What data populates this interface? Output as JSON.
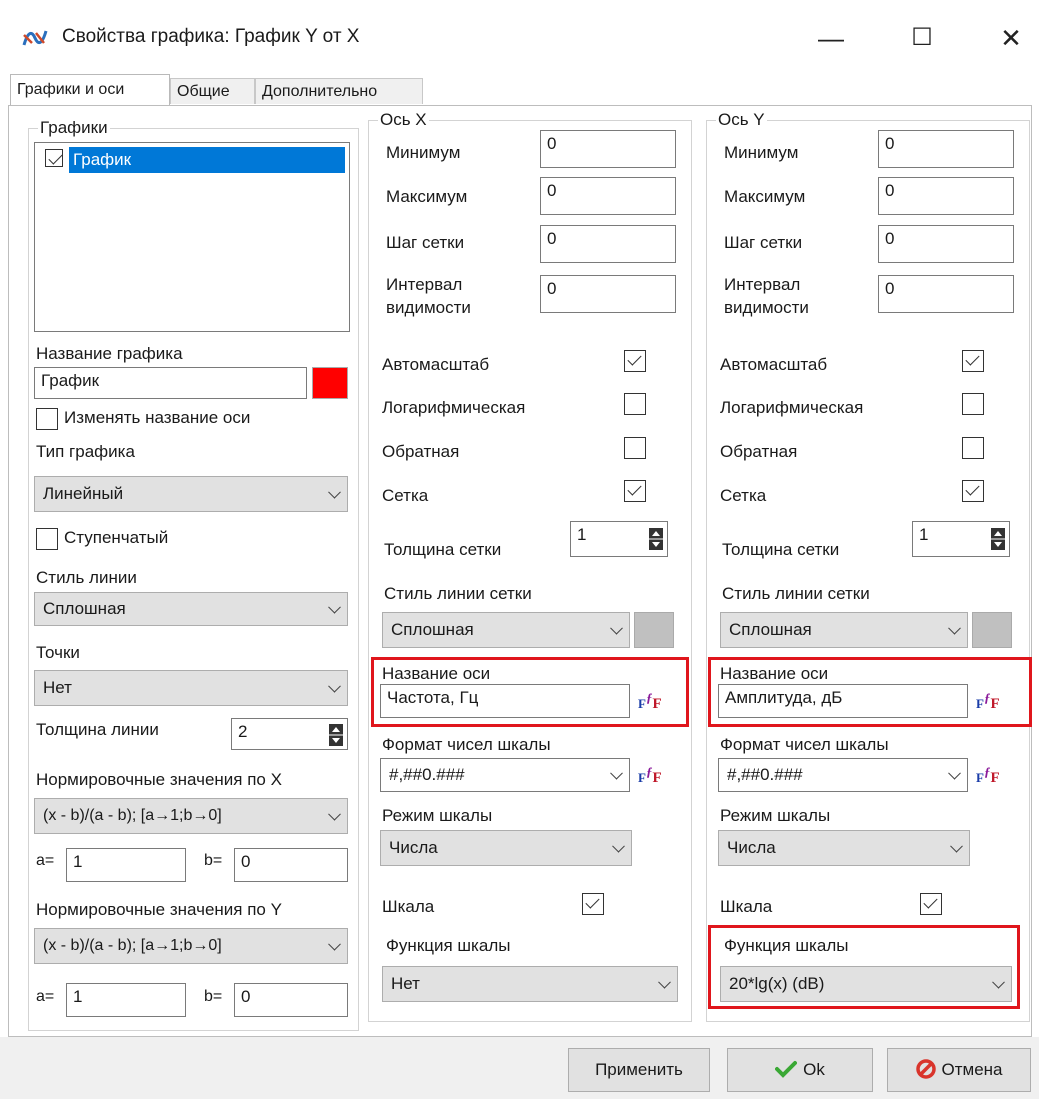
{
  "window": {
    "title": "Свойства графика: График Y от X",
    "minimize_glyph": "—",
    "maximize_glyph": "☐",
    "close_glyph": "✕",
    "app_icon": "graph-app-icon"
  },
  "tabs": [
    {
      "label": "Графики и оси",
      "active": true
    },
    {
      "label": "Общие",
      "active": false
    },
    {
      "label": "Дополнительно",
      "active": false
    }
  ],
  "graphs_panel": {
    "group_label": "Графики",
    "list_items": [
      {
        "label": "График",
        "checked": true,
        "selected": true
      }
    ],
    "name_label": "Название графика",
    "name_value": "График",
    "color": "#ff0000",
    "rename_axis_label": "Изменять название оси",
    "rename_axis_checked": false,
    "type_label": "Тип графика",
    "type_value": "Линейный",
    "stepped_label": "Ступенчатый",
    "stepped_checked": false,
    "line_style_label": "Стиль линии",
    "line_style_value": "Сплошная",
    "points_label": "Точки",
    "points_value": "Нет",
    "line_width_label": "Толщина линии",
    "line_width_value": "2",
    "norm_x_label": "Нормировочные значения по X",
    "norm_x_value": "(x - b)/(a - b);  [a→1;b→0]",
    "norm_x_a_label": "a=",
    "norm_x_a": "1",
    "norm_x_b_label": "b=",
    "norm_x_b": "0",
    "norm_y_label": "Нормировочные значения по Y",
    "norm_y_value": "(x - b)/(a - b);  [a→1;b→0]",
    "norm_y_a_label": "a=",
    "norm_y_a": "1",
    "norm_y_b_label": "b=",
    "norm_y_b": "0"
  },
  "axis_x": {
    "group_label": "Ось X",
    "min_label": "Минимум",
    "min_value": "0",
    "max_label": "Максимум",
    "max_value": "0",
    "grid_step_label": "Шаг сетки",
    "grid_step_value": "0",
    "visible_interval_label_1": "Интервал",
    "visible_interval_label_2": "видимости",
    "visible_interval_value": "0",
    "autoscale_label": "Автомасштаб",
    "autoscale": true,
    "log_label": "Логарифмическая",
    "log": false,
    "reverse_label": "Обратная",
    "reverse": false,
    "grid_label": "Сетка",
    "grid": true,
    "grid_width_label": "Толщина  сетки",
    "grid_width_value": "1",
    "grid_style_label": "Стиль линии сетки",
    "grid_style_value": "Сплошная",
    "grid_color": "#c0c0c0",
    "axis_name_label": "Название оси",
    "axis_name_value": "Частота, Гц",
    "number_format_label": "Формат чисел шкалы",
    "number_format_value": "#,##0.###",
    "scale_mode_label": "Режим шкалы",
    "scale_mode_value": "Числа",
    "scale_label": "Шкала",
    "scale": true,
    "scale_function_label": "Функция шкалы",
    "scale_function_value": "Нет"
  },
  "axis_y": {
    "group_label": "Ось Y",
    "min_label": "Минимум",
    "min_value": "0",
    "max_label": "Максимум",
    "max_value": "0",
    "grid_step_label": "Шаг сетки",
    "grid_step_value": "0",
    "visible_interval_label_1": "Интервал",
    "visible_interval_label_2": "видимости",
    "visible_interval_value": "0",
    "autoscale_label": "Автомасштаб",
    "autoscale": true,
    "log_label": "Логарифмическая",
    "log": false,
    "reverse_label": "Обратная",
    "reverse": false,
    "grid_label": "Сетка",
    "grid": true,
    "grid_width_label": "Толщина  сетки",
    "grid_width_value": "1",
    "grid_style_label": "Стиль линии сетки",
    "grid_style_value": "Сплошная",
    "grid_color": "#c0c0c0",
    "axis_name_label": "Название оси",
    "axis_name_value": "Амплитуда, дБ",
    "number_format_label": "Формат чисел шкалы",
    "number_format_value": "#,##0.###",
    "scale_mode_label": "Режим шкалы",
    "scale_mode_value": "Числа",
    "scale_label": "Шкала",
    "scale": true,
    "scale_function_label": "Функция шкалы",
    "scale_function_value": "20*lg(x)  (dB)"
  },
  "formula_button_glyph": "F",
  "buttons": {
    "apply": "Применить",
    "ok": "Ok",
    "cancel": "Отмена",
    "ok_icon": "check-icon",
    "cancel_icon": "cancel-icon"
  },
  "highlight_color": "#e0161c"
}
